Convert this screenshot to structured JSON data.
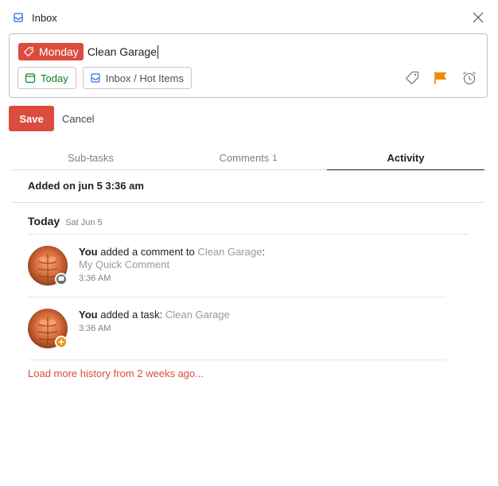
{
  "header": {
    "title": "Inbox",
    "icons": {
      "inbox": "inbox-icon",
      "close": "close-icon"
    }
  },
  "editor": {
    "date_chip": "Monday",
    "task_text": "Clean Garage",
    "due_button": "Today",
    "project_button": "Inbox / Hot Items",
    "action_icons": [
      "label-icon",
      "priority-flag-icon",
      "reminder-alarm-icon"
    ]
  },
  "form": {
    "save_label": "Save",
    "cancel_label": "Cancel"
  },
  "tabs": [
    {
      "label": "Sub-tasks",
      "count": ""
    },
    {
      "label": "Comments",
      "count": "1"
    },
    {
      "label": "Activity",
      "count": ""
    }
  ],
  "activity": {
    "added_on": "Added on jun 5 3:36 am",
    "day_label": "Today",
    "day_date": "Sat Jun 5",
    "events": [
      {
        "actor": "You",
        "action": "added a comment to",
        "target": "Clean Garage",
        "suffix": ":",
        "detail": "My Quick Comment",
        "time": "3:36 AM",
        "badge": "comment-icon"
      },
      {
        "actor": "You",
        "action": "added a task:",
        "target": "Clean Garage",
        "suffix": "",
        "detail": "",
        "time": "3:36 AM",
        "badge": "plus-icon"
      }
    ],
    "load_more": "Load more history from 2 weeks ago..."
  },
  "colors": {
    "accent": "#db4c3f",
    "today_green": "#058527",
    "flag_orange": "#eb8909",
    "plus_badge": "#f28c18",
    "comment_badge": "#6b6b6b"
  }
}
